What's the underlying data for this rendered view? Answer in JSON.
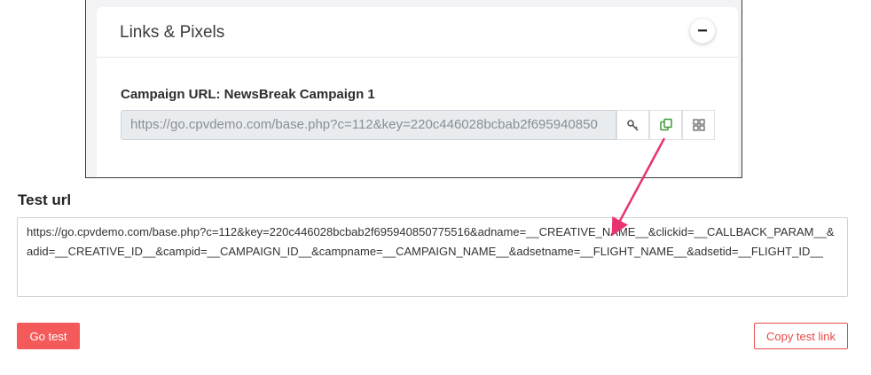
{
  "links_card": {
    "title": "Links & Pixels",
    "collapse_symbol": "−",
    "campaign_label": "Campaign URL: NewsBreak Campaign 1",
    "campaign_url": "https://go.cpvdemo.com/base.php?c=112&key=220c446028bcbab2f695940850",
    "icons": [
      "key-icon",
      "copy-icon",
      "qr-code-icon"
    ]
  },
  "test": {
    "title": "Test url",
    "url": "https://go.cpvdemo.com/base.php?c=112&key=220c446028bcbab2f695940850775516&adname=__CREATIVE_NAME__&clickid=__CALLBACK_PARAM__&adid=__CREATIVE_ID__&campid=__CAMPAIGN_ID__&campname=__CAMPAIGN_NAME__&adsetname=__FLIGHT_NAME__&adsetid=__FLIGHT_ID__",
    "go_label": "Go test",
    "copy_label": "Copy test link"
  },
  "colors": {
    "accent_red": "#f55a5a",
    "annotation_arrow": "#e8336e",
    "copy_icon_green": "#3a9a3a"
  }
}
